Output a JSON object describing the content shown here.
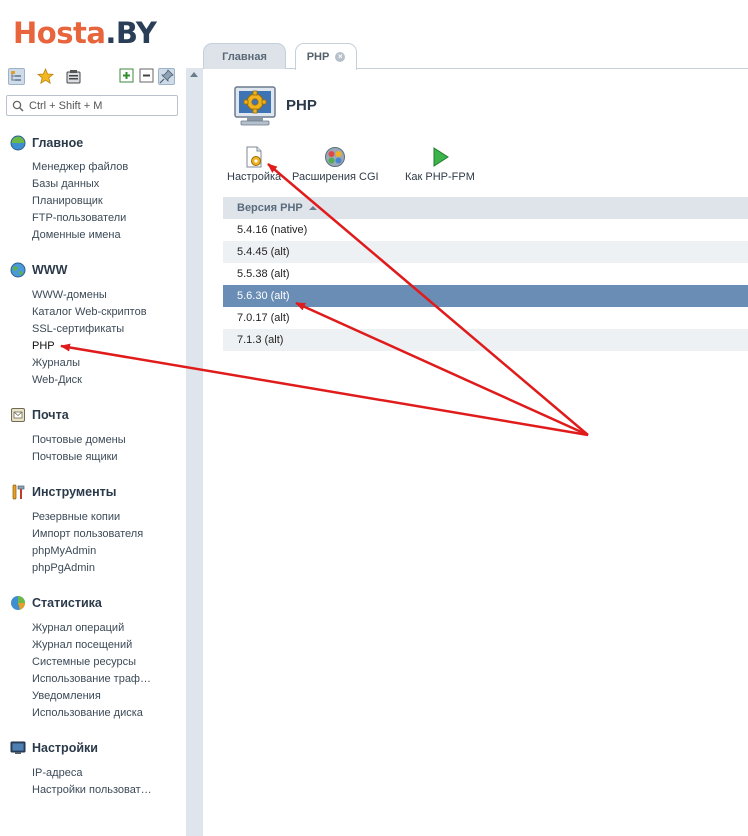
{
  "logo": {
    "part1": "Hosta",
    "part2": ".BY"
  },
  "search": {
    "placeholder": "Ctrl + Shift + M"
  },
  "sidebar": {
    "sections": [
      {
        "title": "Главное",
        "items": [
          "Менеджер файлов",
          "Базы данных",
          "Планировщик",
          "FTP-пользователи",
          "Доменные имена"
        ]
      },
      {
        "title": "WWW",
        "items": [
          "WWW-домены",
          "Каталог Web-скриптов",
          "SSL-сертификаты",
          "PHP",
          "Журналы",
          "Web-Диск"
        ]
      },
      {
        "title": "Почта",
        "items": [
          "Почтовые домены",
          "Почтовые ящики"
        ]
      },
      {
        "title": "Инструменты",
        "items": [
          "Резервные копии",
          "Импорт пользователя",
          "phpMyAdmin",
          "phpPgAdmin"
        ]
      },
      {
        "title": "Статистика",
        "items": [
          "Журнал операций",
          "Журнал посещений",
          "Системные ресурсы",
          "Использование траф…",
          "Уведомления",
          "Использование диска"
        ]
      },
      {
        "title": "Настройки",
        "items": [
          "IP-адреса",
          "Настройки пользоват…"
        ]
      }
    ]
  },
  "tabs": [
    {
      "label": "Главная"
    },
    {
      "label": "PHP"
    }
  ],
  "page": {
    "title": "PHP"
  },
  "toolbar_actions": [
    {
      "label": "Настройка",
      "icon": "settings-doc-icon"
    },
    {
      "label": "Расширения CGI",
      "icon": "extensions-icon"
    },
    {
      "label": "Как PHP-FPM",
      "icon": "play-icon"
    }
  ],
  "table": {
    "column": "Версия PHP",
    "rows": [
      "5.4.16 (native)",
      "5.4.45 (alt)",
      "5.5.38 (alt)",
      "5.6.30 (alt)",
      "7.0.17 (alt)",
      "7.1.3 (alt)"
    ],
    "selected_row": "5.6.30 (alt)"
  },
  "colors": {
    "logo_accent": "#e8643c",
    "logo_dark": "#2a3f57",
    "selection": "#6a8db5",
    "annotation_arrow": "#e01b1b"
  }
}
